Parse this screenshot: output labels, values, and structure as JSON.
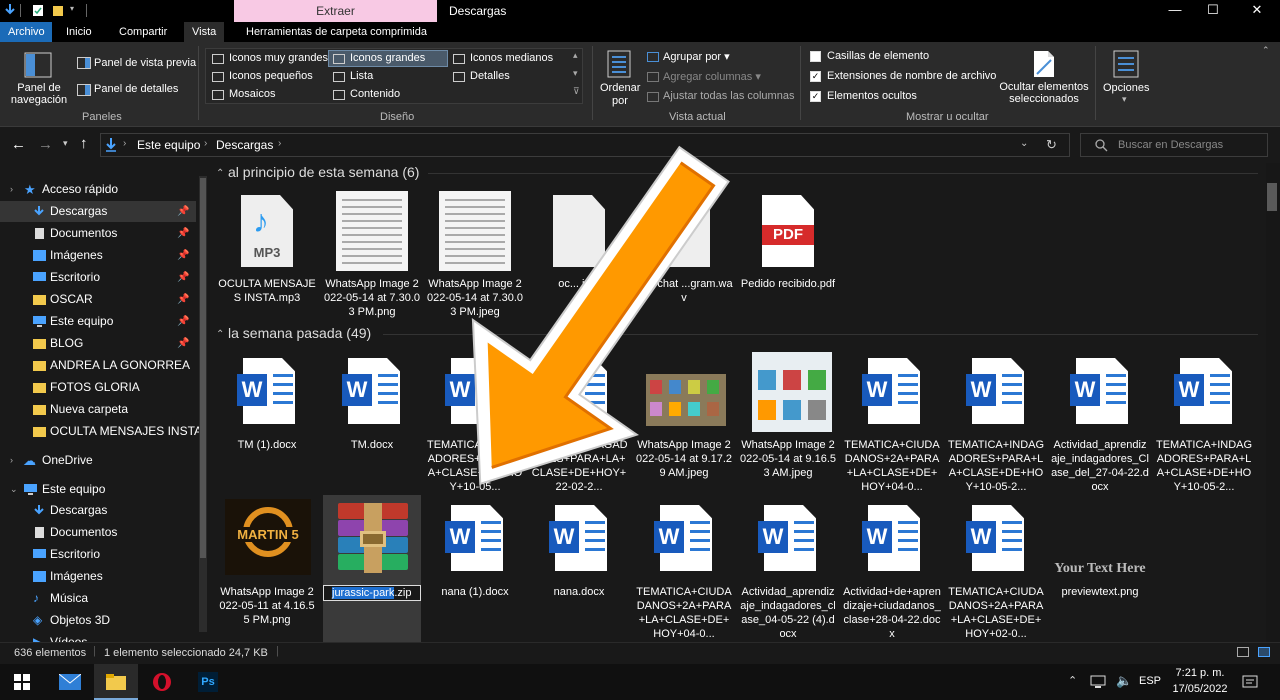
{
  "window": {
    "title": "Descargas",
    "context_tab_header": "Extraer",
    "minimize": "—",
    "maximize": "☐",
    "close": "✕"
  },
  "ribbon_tabs": [
    "Archivo",
    "Inicio",
    "Compartir",
    "Vista",
    "Herramientas de carpeta comprimida"
  ],
  "ribbon": {
    "paneles": {
      "navigation_pane": "Panel de navegación",
      "preview_pane": "Panel de vista previa",
      "details_pane": "Panel de detalles",
      "group": "Paneles"
    },
    "diseno": {
      "layouts": [
        "Iconos muy grandes",
        "Iconos grandes",
        "Iconos medianos",
        "Iconos pequeños",
        "Lista",
        "Detalles",
        "Mosaicos",
        "Contenido"
      ],
      "selected": "Iconos grandes",
      "group": "Diseño"
    },
    "vista_actual": {
      "sort_by": "Ordenar por",
      "group_by": "Agrupar por",
      "add_columns": "Agregar columnas",
      "fit_columns": "Ajustar todas las columnas",
      "group": "Vista actual"
    },
    "mostrar": {
      "item_checkboxes": "Casillas de elemento",
      "extensions": "Extensiones de nombre de archivo",
      "hidden_items": "Elementos ocultos",
      "item_checkboxes_checked": false,
      "extensions_checked": true,
      "hidden_items_checked": true,
      "hide_selected": "Ocultar elementos seleccionados",
      "group": "Mostrar u ocultar"
    },
    "options": "Opciones"
  },
  "address": {
    "crumbs": [
      "Este equipo",
      "Descargas"
    ],
    "search_placeholder": "Buscar en Descargas"
  },
  "sidebar": {
    "quick_access": "Acceso rápido",
    "pinned": [
      "Descargas",
      "Documentos",
      "Imágenes",
      "Escritorio",
      "OSCAR",
      "Este equipo",
      "BLOG"
    ],
    "recent": [
      "ANDREA LA GONORREA",
      "FOTOS GLORIA",
      "Nueva carpeta",
      "OCULTA MENSAJES INSTA"
    ],
    "onedrive": "OneDrive",
    "this_pc": "Este equipo",
    "pc_items": [
      "Descargas",
      "Documentos",
      "Escritorio",
      "Imágenes",
      "Música",
      "Objetos 3D",
      "Vídeos"
    ]
  },
  "groups": [
    {
      "title": "al principio de esta semana (6)",
      "files": [
        {
          "name": "OCULTA MENSAJES INSTA.mp3",
          "kind": "mp3"
        },
        {
          "name": "WhatsApp Image 2022-05-14 at 7.30.03 PM.png",
          "kind": "docimg"
        },
        {
          "name": "WhatsApp Image 2022-05-14 at 7.30.03 PM.jpeg",
          "kind": "docimg"
        },
        {
          "name": "oc... in...",
          "kind": "blank"
        },
        {
          "name": "...ar chat ...gram.wav",
          "kind": "wav"
        },
        {
          "name": "Pedido recibido.pdf",
          "kind": "pdf"
        }
      ]
    },
    {
      "title": "la semana pasada (49)",
      "files": [
        {
          "name": "TM (1).docx",
          "kind": "word"
        },
        {
          "name": "TM.docx",
          "kind": "word"
        },
        {
          "name": "TEMATICA+INDAGADORES+PARA+LA+CLASE+DE+HOY+10-05...",
          "kind": "word"
        },
        {
          "name": "...ATICA+INDAGADORES+PARA+LA+CLASE+DE+HOY+22-02-2...",
          "kind": "word"
        },
        {
          "name": "WhatsApp Image 2022-05-14 at 9.17.29 AM.jpeg",
          "kind": "photo1"
        },
        {
          "name": "WhatsApp Image 2022-05-14 at 9.16.53 AM.jpeg",
          "kind": "photo2"
        },
        {
          "name": "TEMATICA+CIUDADANOS+2A+PARA+LA+CLASE+DE+HOY+04-0...",
          "kind": "word"
        },
        {
          "name": "TEMATICA+INDAGADORES+PARA+LA+CLASE+DE+HOY+10-05-2...",
          "kind": "word"
        },
        {
          "name": "Actividad_aprendizaje_indagadores_Clase_del_27-04-22.docx",
          "kind": "word"
        },
        {
          "name": "TEMATICA+INDAGADORES+PARA+LA+CLASE+DE+HOY+10-05-2...",
          "kind": "word"
        },
        {
          "name": "WhatsApp Image 2022-05-11 at 4.16.55 PM.png",
          "kind": "martin"
        },
        {
          "name": "jurassic-park",
          "ext": ".zip",
          "kind": "zip"
        },
        {
          "name": "nana (1).docx",
          "kind": "word"
        },
        {
          "name": "nana.docx",
          "kind": "word"
        },
        {
          "name": "TEMATICA+CIUDADANOS+2A+PARA+LA+CLASE+DE+HOY+04-0...",
          "kind": "word"
        },
        {
          "name": "Actividad_aprendizaje_indagadores_clase_04-05-22 (4).docx",
          "kind": "word"
        },
        {
          "name": "Actividad+de+aprendizaje+ciudadanos_clase+28-04-22.docx",
          "kind": "word"
        },
        {
          "name": "TEMATICA+CIUDADANOS+2A+PARA+LA+CLASE+DE+HOY+02-0...",
          "kind": "word"
        },
        {
          "name": "previewtext.png",
          "kind": "previewtext",
          "preview_text": "Your Text Here"
        }
      ]
    }
  ],
  "thumb_labels": {
    "mp3": "MP3",
    "pdf": "PDF",
    "word": "W",
    "martin": "MARTIN 5"
  },
  "status": {
    "count": "636 elementos",
    "selection": "1 elemento seleccionado  24,7 KB"
  },
  "taskbar": {
    "lang": "ESP",
    "time": "7:21 p. m.",
    "date": "17/05/2022",
    "ps_label": "Ps"
  },
  "colors": {
    "accent": "#1b6bb8",
    "word_blue": "#185abd",
    "arrow_orange": "#ff9900",
    "pdf_red": "#d62b2b",
    "context_pink": "#f8c9e4"
  }
}
